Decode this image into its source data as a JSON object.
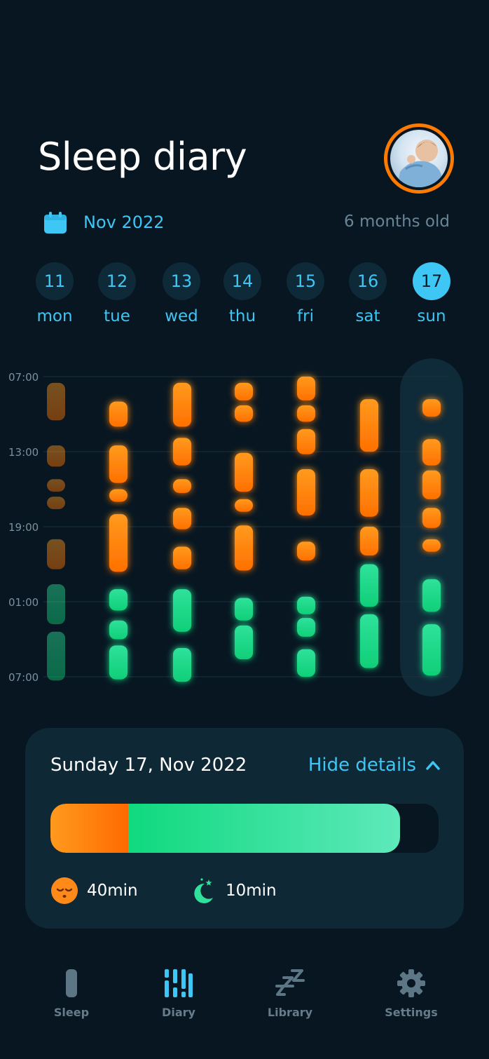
{
  "header": {
    "title": "Sleep diary"
  },
  "calendar": {
    "month": "Nov 2022",
    "age": "6 months old"
  },
  "days": [
    {
      "num": "11",
      "name": "mon",
      "active": false
    },
    {
      "num": "12",
      "name": "tue",
      "active": false
    },
    {
      "num": "13",
      "name": "wed",
      "active": false
    },
    {
      "num": "14",
      "name": "thu",
      "active": false
    },
    {
      "num": "15",
      "name": "fri",
      "active": false
    },
    {
      "num": "16",
      "name": "sat",
      "active": false
    },
    {
      "num": "17",
      "name": "sun",
      "active": true
    }
  ],
  "chart_data": {
    "type": "range-bar",
    "y_ticks": [
      "07:00",
      "13:00",
      "19:00",
      "01:00",
      "07:00"
    ],
    "y_range_hours": [
      7,
      31
    ],
    "legend": {
      "day_color": "#ff7a00",
      "night_color": "#10d884"
    },
    "selected_day_index": 6,
    "series": [
      {
        "day": "mon",
        "segments": [
          {
            "start": 7.5,
            "end": 10.5,
            "kind": "day"
          },
          {
            "start": 12.5,
            "end": 14.2,
            "kind": "day"
          },
          {
            "start": 15.2,
            "end": 16.2,
            "kind": "day"
          },
          {
            "start": 16.6,
            "end": 17.6,
            "kind": "day"
          },
          {
            "start": 20.0,
            "end": 22.4,
            "kind": "day"
          },
          {
            "start": 23.6,
            "end": 26.8,
            "kind": "night"
          },
          {
            "start": 27.4,
            "end": 31.3,
            "kind": "night"
          }
        ]
      },
      {
        "day": "tue",
        "segments": [
          {
            "start": 9.0,
            "end": 11.0,
            "kind": "day"
          },
          {
            "start": 12.5,
            "end": 15.5,
            "kind": "day"
          },
          {
            "start": 16.0,
            "end": 17.0,
            "kind": "day"
          },
          {
            "start": 18.0,
            "end": 22.6,
            "kind": "day"
          },
          {
            "start": 24.0,
            "end": 25.7,
            "kind": "night"
          },
          {
            "start": 26.5,
            "end": 28.0,
            "kind": "night"
          },
          {
            "start": 28.5,
            "end": 31.2,
            "kind": "night"
          }
        ]
      },
      {
        "day": "wed",
        "segments": [
          {
            "start": 7.5,
            "end": 11.0,
            "kind": "day"
          },
          {
            "start": 11.9,
            "end": 14.1,
            "kind": "day"
          },
          {
            "start": 15.2,
            "end": 16.3,
            "kind": "day"
          },
          {
            "start": 17.5,
            "end": 19.2,
            "kind": "day"
          },
          {
            "start": 20.6,
            "end": 22.4,
            "kind": "day"
          },
          {
            "start": 24.0,
            "end": 27.4,
            "kind": "night"
          },
          {
            "start": 28.7,
            "end": 31.4,
            "kind": "night"
          }
        ]
      },
      {
        "day": "thu",
        "segments": [
          {
            "start": 7.5,
            "end": 8.9,
            "kind": "day"
          },
          {
            "start": 9.3,
            "end": 10.6,
            "kind": "day"
          },
          {
            "start": 13.1,
            "end": 16.2,
            "kind": "day"
          },
          {
            "start": 16.8,
            "end": 17.8,
            "kind": "day"
          },
          {
            "start": 18.9,
            "end": 22.5,
            "kind": "day"
          },
          {
            "start": 24.7,
            "end": 26.5,
            "kind": "night"
          },
          {
            "start": 26.9,
            "end": 29.6,
            "kind": "night"
          }
        ]
      },
      {
        "day": "fri",
        "segments": [
          {
            "start": 7.0,
            "end": 8.9,
            "kind": "day"
          },
          {
            "start": 9.3,
            "end": 10.6,
            "kind": "day"
          },
          {
            "start": 11.2,
            "end": 13.2,
            "kind": "day"
          },
          {
            "start": 14.4,
            "end": 18.1,
            "kind": "day"
          },
          {
            "start": 20.2,
            "end": 21.7,
            "kind": "day"
          },
          {
            "start": 24.6,
            "end": 26.0,
            "kind": "night"
          },
          {
            "start": 26.3,
            "end": 27.8,
            "kind": "night"
          },
          {
            "start": 28.8,
            "end": 31.0,
            "kind": "night"
          }
        ]
      },
      {
        "day": "sat",
        "segments": [
          {
            "start": 8.8,
            "end": 13.0,
            "kind": "day"
          },
          {
            "start": 14.4,
            "end": 18.2,
            "kind": "day"
          },
          {
            "start": 19.0,
            "end": 21.3,
            "kind": "day"
          },
          {
            "start": 22.0,
            "end": 25.4,
            "kind": "night"
          },
          {
            "start": 26.0,
            "end": 30.3,
            "kind": "night"
          }
        ]
      },
      {
        "day": "sun",
        "segments": [
          {
            "start": 8.8,
            "end": 10.2,
            "kind": "day"
          },
          {
            "start": 12.0,
            "end": 14.1,
            "kind": "day"
          },
          {
            "start": 14.5,
            "end": 16.8,
            "kind": "day"
          },
          {
            "start": 17.5,
            "end": 19.1,
            "kind": "day"
          },
          {
            "start": 20.0,
            "end": 21.0,
            "kind": "day"
          },
          {
            "start": 23.2,
            "end": 25.8,
            "kind": "night"
          },
          {
            "start": 26.8,
            "end": 30.9,
            "kind": "night"
          }
        ]
      }
    ]
  },
  "details": {
    "date": "Sunday 17, Nov 2022",
    "toggle_label": "Hide details",
    "bar": {
      "day_fraction": 0.2,
      "night_fraction": 0.7
    },
    "day_nap": {
      "icon": "sleepy-face-icon",
      "value": "40min"
    },
    "night_sleep": {
      "icon": "moon-stars-icon",
      "value": "10min"
    }
  },
  "nav": {
    "items": [
      {
        "label": "Sleep",
        "icon": "sleep-bar-icon",
        "active": false
      },
      {
        "label": "Diary",
        "icon": "diary-bars-icon",
        "active": true
      },
      {
        "label": "Library",
        "icon": "zzz-icon",
        "active": false
      },
      {
        "label": "Settings",
        "icon": "gear-icon",
        "active": false
      }
    ]
  }
}
